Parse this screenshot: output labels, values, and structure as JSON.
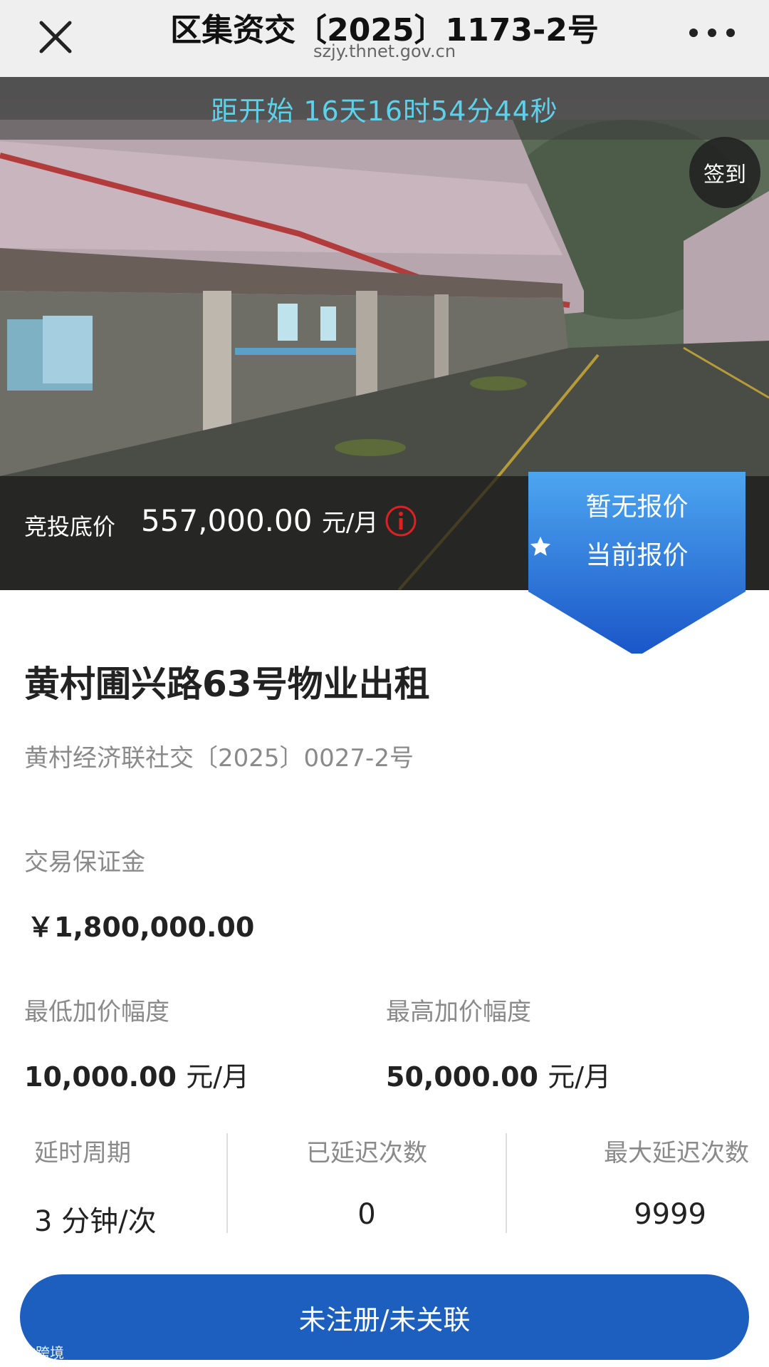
{
  "header": {
    "title": "区集资交〔2025〕1173-2号",
    "url": "szjy.thnet.gov.cn",
    "icons": {
      "close": "close-icon",
      "more": "more-icon"
    }
  },
  "hero": {
    "countdown": "距开始  16天16时54分44秒",
    "checkin_label": "签到",
    "price_label": "竞投底价",
    "price_value": "557,000.00",
    "price_unit": "元/月",
    "quote_status": "暂无报价",
    "quote_current_label": "当前报价"
  },
  "item": {
    "title": "黄村圃兴路63号物业出租",
    "code": "黄村经济联社交〔2025〕0027-2号"
  },
  "details": {
    "deposit_label": "交易保证金",
    "deposit_value": "￥1,800,000.00",
    "min_step_label": "最低加价幅度",
    "min_step_value": "10,000.00",
    "min_step_unit": "元/月",
    "max_step_label": "最高加价幅度",
    "max_step_value": "50,000.00",
    "max_step_unit": "元/月"
  },
  "stats": {
    "delay_period_label": "延时周期",
    "delay_period_value": "3 分钟/次",
    "delayed_count_label": "已延迟次数",
    "delayed_count_value": "0",
    "max_delay_label": "最大延迟次数",
    "max_delay_value": "9999"
  },
  "action": {
    "button_label": "未注册/未关联"
  },
  "watermark": "大数跨境",
  "colors": {
    "countdown_text": "#5fd0ea",
    "primary_blue": "#1d5fbf",
    "ribbon_top": "#4da6f0",
    "ribbon_bottom": "#1a56c8",
    "info_red": "#e02020"
  }
}
